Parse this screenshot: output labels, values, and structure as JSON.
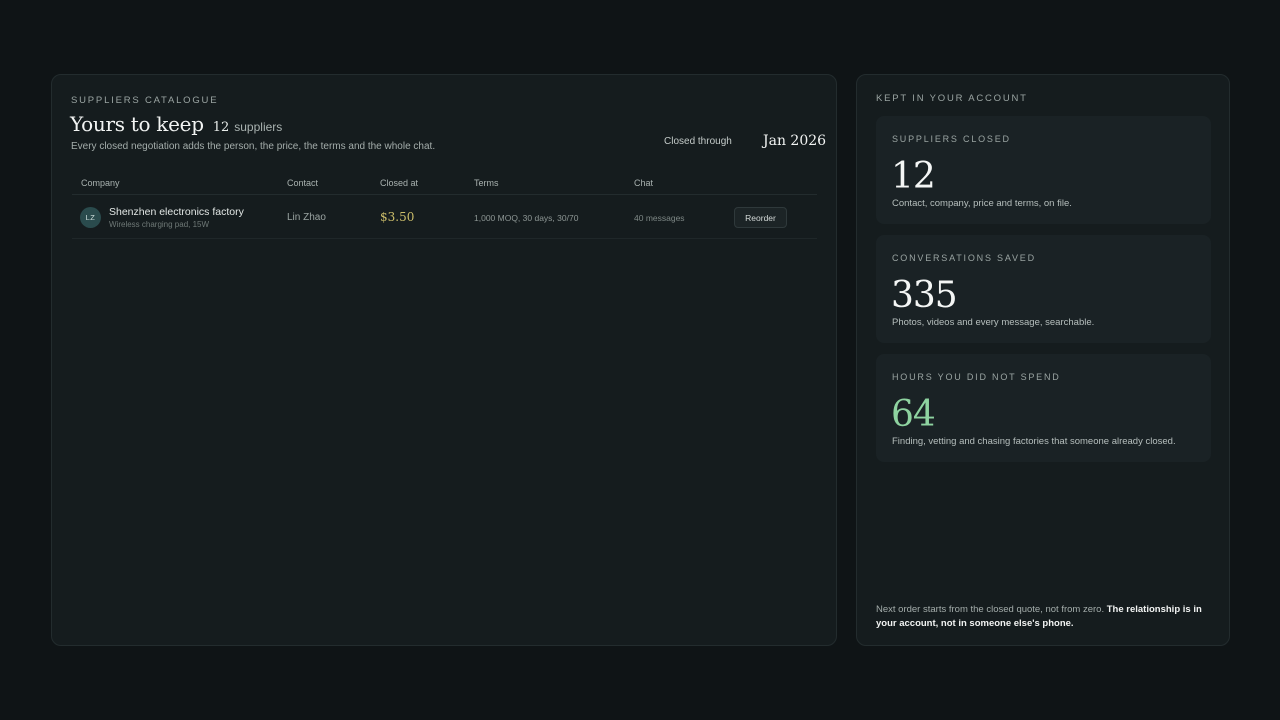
{
  "catalogue": {
    "eyebrow": "SUPPLIERS CATALOGUE",
    "title": "Yours to keep",
    "count": "12",
    "count_label": "suppliers",
    "subtitle": "Every closed negotiation adds the person, the price, the terms and the whole chat.",
    "closed_through_label": "Closed through",
    "closed_through_value": "Jan 2026",
    "columns": [
      "Company",
      "Contact",
      "Closed at",
      "Terms",
      "Chat"
    ],
    "rows": [
      {
        "initials": "LZ",
        "company": "Shenzhen electronics factory",
        "product": "Wireless charging pad, 15W",
        "contact": "Lin Zhao",
        "price": "$3.50",
        "terms": "1,000 MOQ, 30 days, 30/70",
        "chat": "40 messages",
        "action": "Reorder"
      }
    ]
  },
  "account": {
    "eyebrow": "KEPT IN YOUR ACCOUNT",
    "stats": [
      {
        "label": "SUPPLIERS CLOSED",
        "value": "12",
        "desc": "Contact, company, price and terms, on file."
      },
      {
        "label": "CONVERSATIONS SAVED",
        "value": "335",
        "desc": "Photos, videos and every message, searchable."
      },
      {
        "label": "HOURS YOU DID NOT SPEND",
        "value": "64",
        "desc": "Finding, vetting and chasing factories that someone already closed."
      }
    ],
    "note_plain": "Next order starts from the closed quote, not from zero.",
    "note_bold": "The relationship is in your account, not in someone else's phone."
  },
  "colors": {
    "background": "#0f1416",
    "panel": "#151c1e",
    "price_accent": "#cbbd6a",
    "hours_accent": "#8ed3a0"
  }
}
